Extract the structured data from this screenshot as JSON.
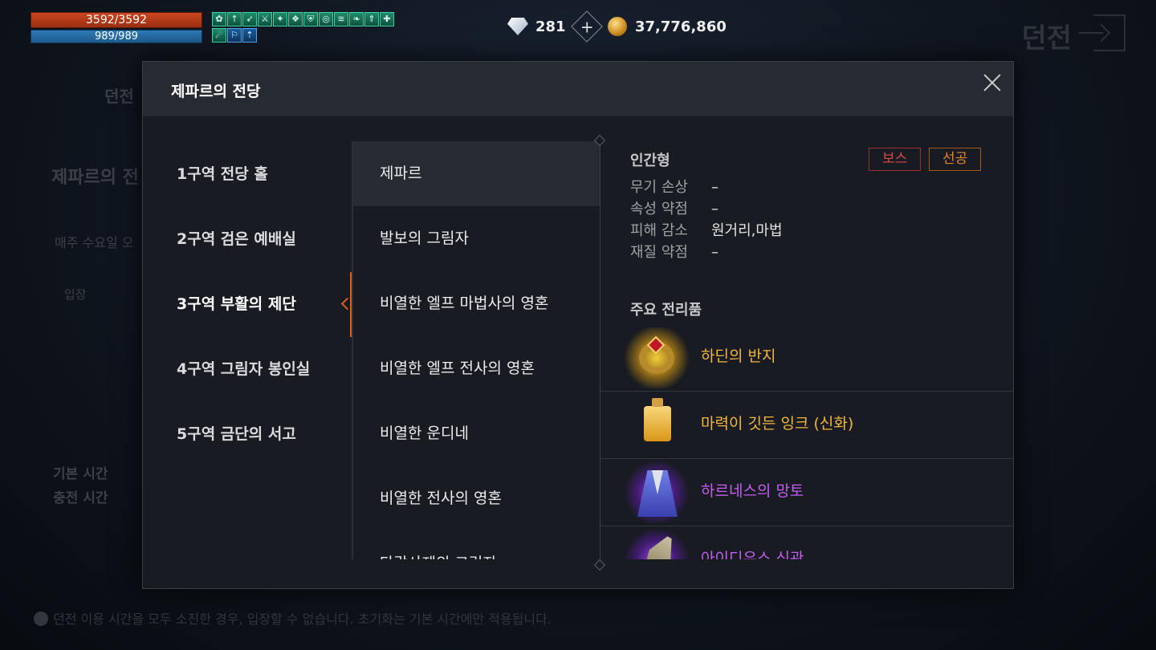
{
  "hud": {
    "hp": "3592/3592",
    "mp": "989/989",
    "buff_icons": [
      "leaf",
      "arrow",
      "dash",
      "sword",
      "star",
      "shield",
      "guard",
      "ring",
      "wind",
      "feather",
      "spear",
      "cross",
      "claw",
      "stance",
      "arrow-up"
    ],
    "gems": "281",
    "gold": "37,776,860"
  },
  "background": {
    "title": "던전",
    "menu_item": "던전",
    "dungeon_name": "제파르의 전",
    "reset_info": "매주 수요일 오",
    "enter_button": "입장",
    "base_time_label": "기본 시간",
    "charge_time_label": "충전 시간",
    "footer_note": "던전 이용 시간을 모두 소진한 경우, 입장할 수 없습니다. 초기화는 기본 시간에만 적용됩니다."
  },
  "dialog": {
    "title": "제파르의 전당",
    "zones": [
      {
        "label": "1구역 전당 홀"
      },
      {
        "label": "2구역 검은 예배실"
      },
      {
        "label": "3구역 부활의 제단"
      },
      {
        "label": "4구역 그림자 봉인실"
      },
      {
        "label": "5구역 금단의 서고"
      }
    ],
    "active_zone": 2,
    "monsters": [
      {
        "label": "제파르"
      },
      {
        "label": "발보의 그림자"
      },
      {
        "label": "비열한 엘프 마법사의 영혼"
      },
      {
        "label": "비열한 엘프 전사의 영혼"
      },
      {
        "label": "비열한 운디네"
      },
      {
        "label": "비열한 전사의 영혼"
      },
      {
        "label": "타락사제의 그림자"
      }
    ],
    "active_monster": 0,
    "details": {
      "type": "인간형",
      "tags": {
        "boss": "보스",
        "first_strike": "선공"
      },
      "props": [
        {
          "key": "무기 손상",
          "value": "–"
        },
        {
          "key": "속성 약점",
          "value": "–"
        },
        {
          "key": "피해 감소",
          "value": "원거리,마법"
        },
        {
          "key": "재질 약점",
          "value": "–"
        }
      ],
      "loot_title": "주요 전리품",
      "loot": [
        {
          "name": "하딘의 반지",
          "rarity": "legendary",
          "icon": "ring-icon"
        },
        {
          "name": "마력이 깃든 잉크 (신화)",
          "rarity": "legendary",
          "icon": "ink-bottle-icon"
        },
        {
          "name": "하르네스의 망토",
          "rarity": "epic",
          "icon": "cloak-icon"
        },
        {
          "name": "아이디우스 신관",
          "rarity": "epic",
          "icon": "weapon-icon"
        }
      ]
    }
  },
  "colors": {
    "legendary": "#f2b63c",
    "epic": "#c45ef0",
    "accent": "#d8621b"
  }
}
